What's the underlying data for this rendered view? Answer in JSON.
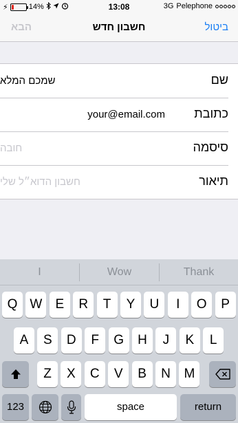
{
  "status_bar": {
    "battery_percent": "14%",
    "battery_level": 0.14,
    "time": "13:08",
    "network": "3G",
    "carrier": "Pelephone",
    "icons": [
      "bluetooth-icon",
      "location-icon",
      "alarm-icon"
    ]
  },
  "nav": {
    "title": "חשבון חדש",
    "cancel_label": "ביטול",
    "next_label": "הבא",
    "accent_color": "#1a7ef5"
  },
  "form": {
    "rows": [
      {
        "label": "שם",
        "value": "שמכם המלא",
        "placeholder": ""
      },
      {
        "label": "כתובת",
        "value": "your@email.com",
        "placeholder": ""
      },
      {
        "label": "סיסמה",
        "value": "",
        "placeholder": "חובה"
      },
      {
        "label": "תיאור",
        "value": "",
        "placeholder": "חשבון הדוא״ל שלי"
      }
    ]
  },
  "keyboard": {
    "suggestions": [
      "I",
      "Wow",
      "Thank"
    ],
    "row1": [
      "Q",
      "W",
      "E",
      "R",
      "T",
      "Y",
      "U",
      "I",
      "O",
      "P"
    ],
    "row2": [
      "A",
      "S",
      "D",
      "F",
      "G",
      "H",
      "J",
      "K",
      "L"
    ],
    "row3": [
      "Z",
      "X",
      "C",
      "V",
      "B",
      "N",
      "M"
    ],
    "numbers_label": "123",
    "space_label": "space",
    "return_label": "return"
  }
}
